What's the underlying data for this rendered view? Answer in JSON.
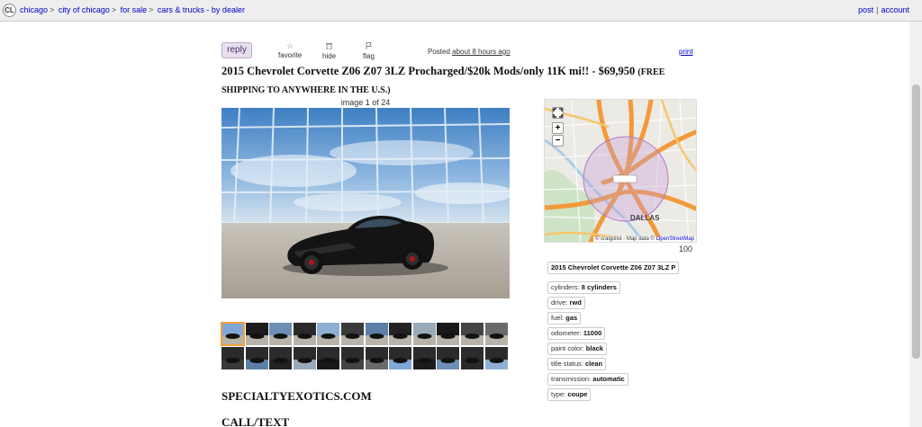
{
  "topbar": {
    "logo": "CL",
    "breadcrumbs": [
      "chicago",
      "city of chicago",
      "for sale",
      "cars & trucks - by dealer"
    ],
    "separator": ">",
    "post": "post",
    "divider": "|",
    "account": "account"
  },
  "actions": {
    "reply": "reply",
    "favorite": "favorite",
    "hide": "hide",
    "flag": "flag",
    "posted_label": "Posted",
    "posted_time": "about 8 hours ago",
    "print": "print"
  },
  "listing": {
    "title": "2015 Chevrolet Corvette Z06 Z07 3LZ Procharged/$20k Mods/only 11K mi!! - $69,950",
    "shipping": "(FREE SHIPPING TO ANYWHERE IN THE U.S.)",
    "image_counter": "image 1 of 24",
    "thumbnail_count": 24,
    "dealer": "SPECIALTYEXOTICS.COM",
    "call": "CALL/TEXT"
  },
  "map": {
    "city_label": "DALLAS",
    "fullscreen": "⛶",
    "zoom_in": "+",
    "zoom_out": "−",
    "attribution_prefix": "© craigslist - Map data ©",
    "attribution_link": "OpenStreetMap",
    "zoom_level": "100",
    "colors": {
      "land": "#eceae4",
      "highway": "#f29a3a",
      "radius": "#c79cd9"
    }
  },
  "attributes": {
    "name": "2015 Chevrolet Corvette Z06 Z07 3LZ P",
    "items": [
      {
        "label": "cylinders:",
        "value": "8 cylinders"
      },
      {
        "label": "drive:",
        "value": "rwd"
      },
      {
        "label": "fuel:",
        "value": "gas"
      },
      {
        "label": "odometer:",
        "value": "11000"
      },
      {
        "label": "paint color:",
        "value": "black"
      },
      {
        "label": "title status:",
        "value": "clean"
      },
      {
        "label": "transmission:",
        "value": "automatic"
      },
      {
        "label": "type:",
        "value": "coupe"
      }
    ]
  }
}
